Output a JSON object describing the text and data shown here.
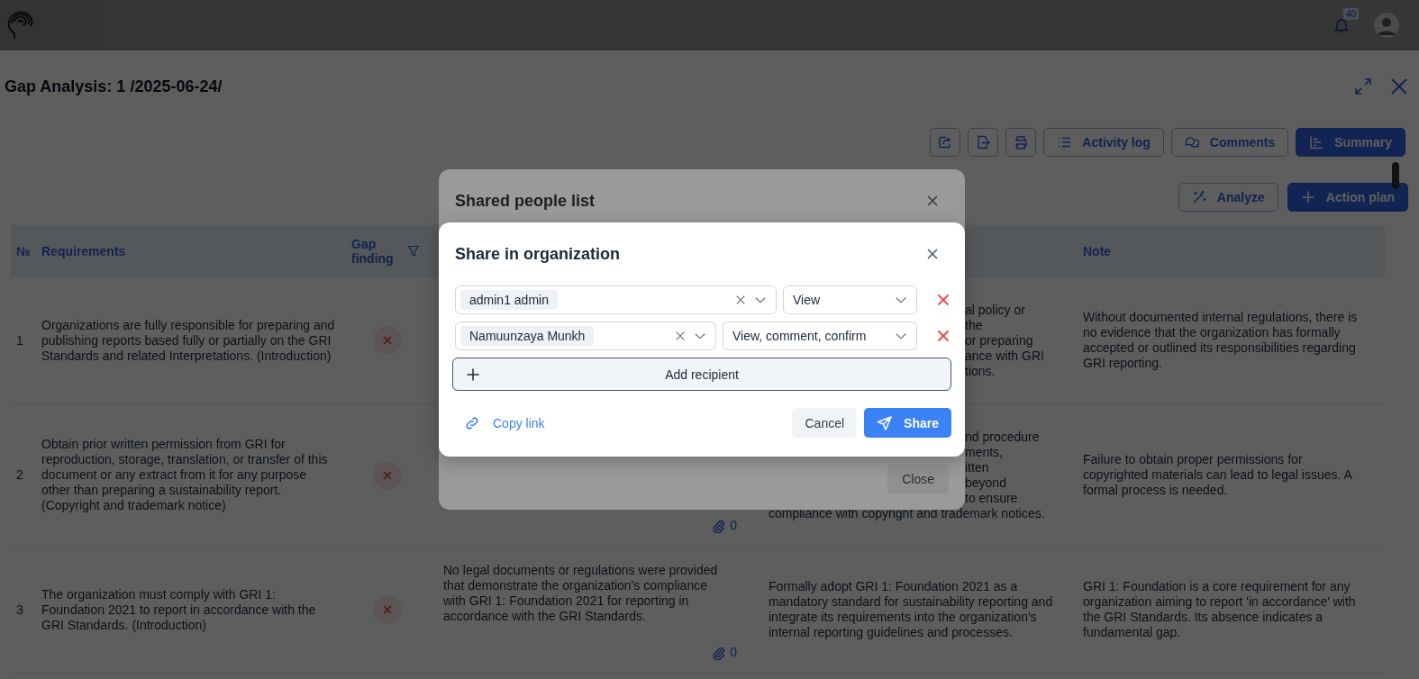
{
  "top_bar": {
    "notifications": "40"
  },
  "page": {
    "title": "Gap Analysis: 1 /2025-06-24/",
    "toolbar": [
      {
        "label": "Activity log",
        "primary": false
      },
      {
        "label": "Comments",
        "primary": false
      },
      {
        "label": "Summary",
        "primary": true
      }
    ],
    "actions": [
      {
        "label": "Analyze",
        "primary": false
      },
      {
        "label": "Action plan",
        "primary": true
      }
    ]
  },
  "table": {
    "columns": {
      "number": "№",
      "requirements": "Requirements",
      "gap_finding": "Gap finding",
      "note": "Note"
    },
    "rows": [
      {
        "number": "1",
        "requirement": "Organizations are fully responsible for preparing and publishing reports based fully or partially on the GRI Standards and related Interpretations. (Introduction)",
        "gap_found": true,
        "action_fragment": "al policy or\nthe\nor preparing\nance with GRI\ntions.",
        "note": "Without documented internal regulations, there is no evidence that the organization has formally accepted or outlined its responsibilities regarding GRI reporting."
      },
      {
        "number": "2",
        "requirement": "Obtain prior written permission from GRI for reproduction, storage, translation, or transfer of this document or any extract from it for any purpose other than preparing a sustainability report. (Copyright and trademark notice)",
        "gap_found": true,
        "attachments": "0",
        "action_fragment": "nd procedure\nments,\nitten\nbeyond\nto ensure",
        "action": "compliance with copyright and trademark notices.",
        "note": "Failure to obtain proper permissions for copyrighted materials can lead to legal issues. A formal process is needed."
      },
      {
        "number": "3",
        "requirement": "The organization must comply with GRI 1: Foundation 2021 to report in accordance with the GRI Standards. (Introduction)",
        "gap_found": true,
        "comment": "No legal documents or regulations were provided that demonstrate the organization's compliance with GRI 1: Foundation 2021 for reporting in accordance with the GRI Standards.",
        "attachments": "0",
        "action": "Formally adopt GRI 1: Foundation 2021 as a mandatory standard for sustainability reporting and integrate its requirements into the organization's internal reporting guidelines and processes.",
        "note": "GRI 1: Foundation is a core requirement for any organization aiming to report 'in accordance' with the GRI Standards. Its absence indicates a fundamental gap."
      }
    ]
  },
  "shared_list_dialog": {
    "title": "Shared people list",
    "close_label": "Close"
  },
  "share_dialog": {
    "title": "Share in organization",
    "recipients": [
      {
        "name": "admin1 admin",
        "permission": "View"
      },
      {
        "name": "Namuunzaya Munkh",
        "permission": "View, comment, confirm"
      }
    ],
    "add_label": "Add recipient",
    "copy_link": "Copy link",
    "cancel": "Cancel",
    "share": "Share"
  }
}
